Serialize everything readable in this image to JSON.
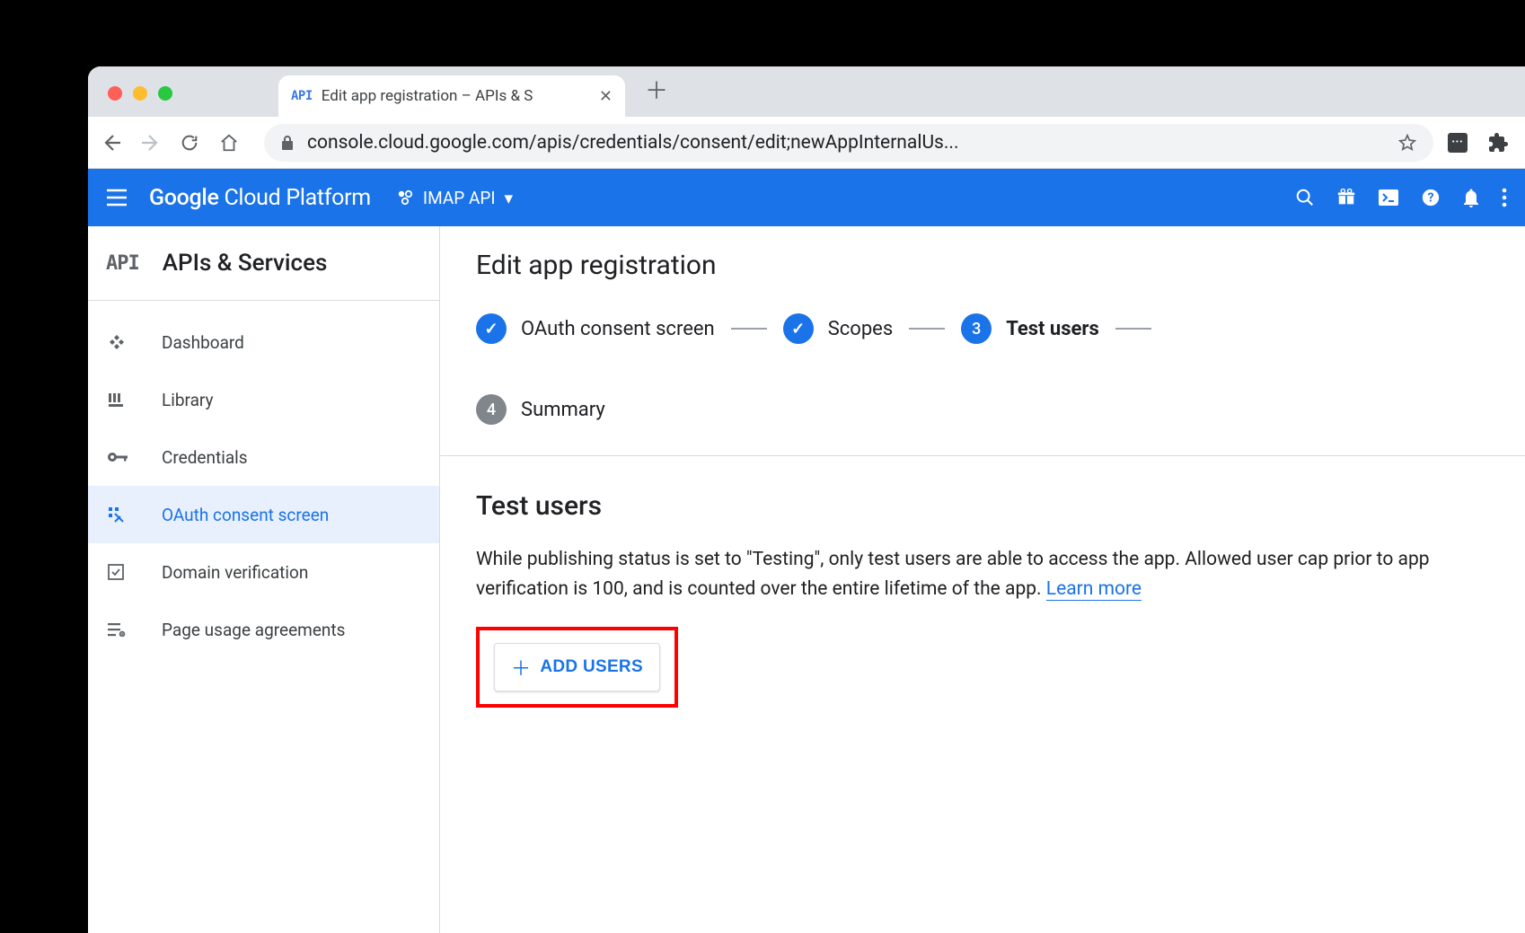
{
  "browser": {
    "tab_title": "Edit app registration – APIs & S",
    "url": "console.cloud.google.com/apis/credentials/consent/edit;newAppInternalUs..."
  },
  "gcp_header": {
    "logo_left": "Google",
    "logo_right": "Cloud Platform",
    "project": "IMAP API"
  },
  "sidebar": {
    "section_icon": "API",
    "section_title": "APIs & Services",
    "items": [
      {
        "label": "Dashboard"
      },
      {
        "label": "Library"
      },
      {
        "label": "Credentials"
      },
      {
        "label": "OAuth consent screen"
      },
      {
        "label": "Domain verification"
      },
      {
        "label": "Page usage agreements"
      }
    ]
  },
  "main": {
    "page_title": "Edit app registration",
    "steps": [
      {
        "label": "OAuth consent screen",
        "state": "done"
      },
      {
        "label": "Scopes",
        "state": "done"
      },
      {
        "num": "3",
        "label": "Test users",
        "state": "current"
      },
      {
        "num": "4",
        "label": "Summary",
        "state": "pending"
      }
    ],
    "section": {
      "title": "Test users",
      "text": "While publishing status is set to \"Testing\", only test users are able to access the app. Allowed user cap prior to app verification is 100, and is counted over the entire lifetime of the app. ",
      "learn_more": "Learn more",
      "add_users_label": "ADD USERS"
    }
  }
}
